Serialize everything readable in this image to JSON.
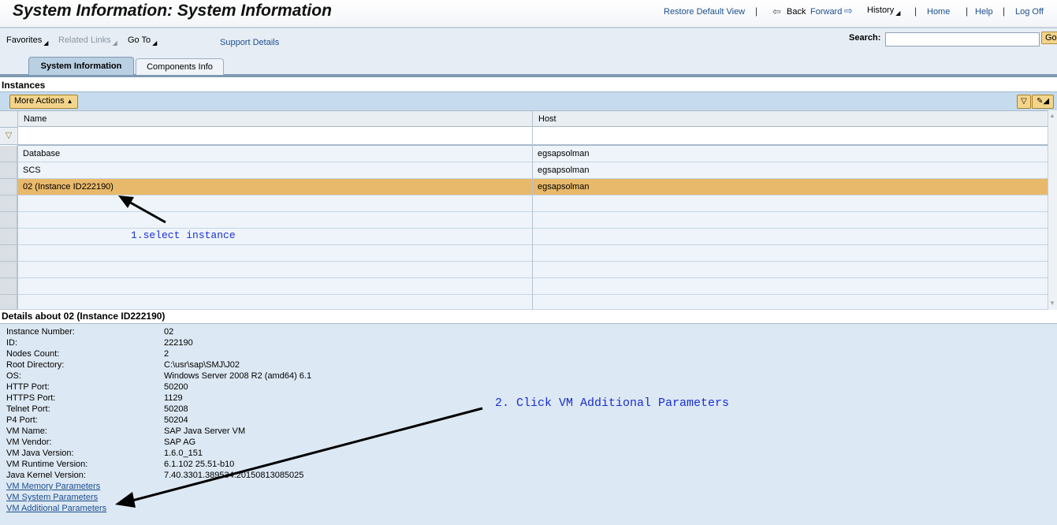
{
  "header": {
    "title": "System Information: System Information",
    "links": {
      "restore_default_view": "Restore Default View",
      "back": "Back",
      "forward": "Forward",
      "history": "History",
      "home": "Home",
      "help": "Help",
      "log_off": "Log Off"
    }
  },
  "navbar": {
    "favorites": "Favorites",
    "related_links": "Related Links",
    "go_to": "Go To",
    "support_details": "Support Details",
    "search_label": "Search:",
    "search_value": "",
    "go_button": "Go"
  },
  "tabs": [
    {
      "label": "System Information",
      "active": true
    },
    {
      "label": "Components Info",
      "active": false
    }
  ],
  "instances": {
    "title": "Instances",
    "more_actions": "More Actions",
    "columns": [
      "Name",
      "Host"
    ],
    "rows": [
      {
        "name": "Database",
        "host": "egsapsolman",
        "selected": false
      },
      {
        "name": "SCS",
        "host": "egsapsolman",
        "selected": false
      },
      {
        "name": "02 (Instance ID222190)",
        "host": "egsapsolman",
        "selected": true
      }
    ]
  },
  "details": {
    "title": "Details about 02 (Instance ID222190)",
    "fields": [
      {
        "label": "Instance Number:",
        "value": "02"
      },
      {
        "label": "ID:",
        "value": "222190"
      },
      {
        "label": "Nodes Count:",
        "value": "2"
      },
      {
        "label": "Root Directory:",
        "value": "C:\\usr\\sap\\SMJ\\J02"
      },
      {
        "label": "OS:",
        "value": "Windows Server 2008 R2 (amd64) 6.1"
      },
      {
        "label": "HTTP Port:",
        "value": "50200"
      },
      {
        "label": "HTTPS Port:",
        "value": "1129"
      },
      {
        "label": "Telnet Port:",
        "value": "50208"
      },
      {
        "label": "P4 Port:",
        "value": "50204"
      },
      {
        "label": "VM Name:",
        "value": "SAP Java Server VM"
      },
      {
        "label": "VM Vendor:",
        "value": "SAP AG"
      },
      {
        "label": "VM Java Version:",
        "value": "1.6.0_151"
      },
      {
        "label": "VM Runtime Version:",
        "value": "6.1.102 25.51-b10"
      },
      {
        "label": "Java Kernel Version:",
        "value": "7.40.3301.389534.20150813085025"
      }
    ],
    "links": [
      "VM Memory Parameters",
      "VM System Parameters",
      "VM Additional Parameters"
    ]
  },
  "annotations": {
    "step1": "1.select instance",
    "step2": "2. Click VM Additional Parameters"
  },
  "colors": {
    "selected_row": "#e8b96a",
    "link": "#1d4f8f",
    "annotation": "#1a2fd0"
  }
}
